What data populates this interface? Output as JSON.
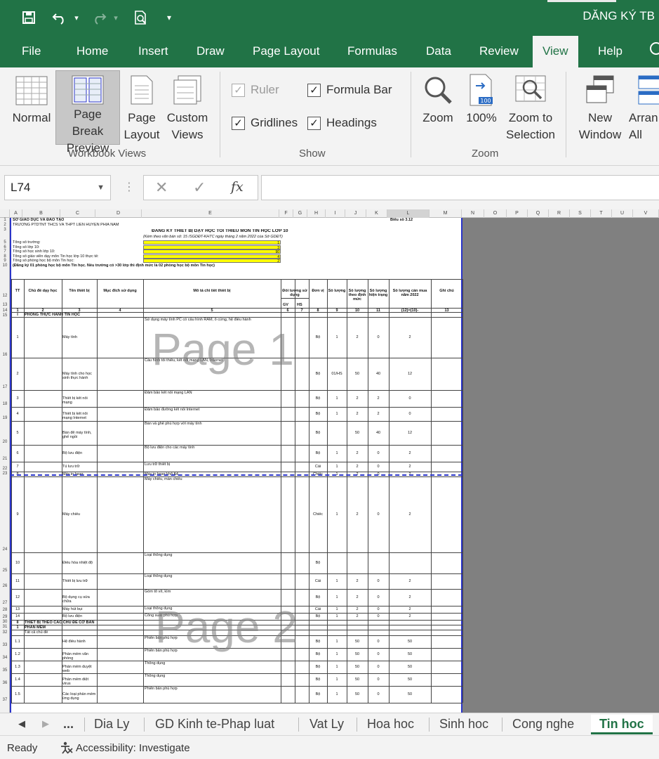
{
  "app": {
    "doc_title": "DĂNG KÝ TB"
  },
  "quick_access": {
    "save": "💾",
    "undo": "↶",
    "redo": "↷",
    "preview": "🔍",
    "customize": "▾"
  },
  "tabs": [
    "File",
    "Home",
    "Insert",
    "Draw",
    "Page Layout",
    "Formulas",
    "Data",
    "Review",
    "View",
    "Help"
  ],
  "ribbon": {
    "workbook_views": {
      "label": "Workbook Views",
      "normal": "Normal",
      "page_break": "Page Break Preview",
      "page_layout": "Page Layout",
      "custom_views": "Custom Views"
    },
    "show": {
      "label": "Show",
      "ruler": "Ruler",
      "formula_bar": "Formula Bar",
      "gridlines": "Gridlines",
      "headings": "Headings"
    },
    "zoom": {
      "label": "Zoom",
      "zoom": "Zoom",
      "hundred": "100%",
      "zoom_sel": "Zoom to Selection"
    },
    "window": {
      "new_window": "New Window",
      "arrange": "Arran All"
    }
  },
  "formula_bar": {
    "name_box": "L74",
    "cancel": "✕",
    "enter": "✓",
    "fx": "fx",
    "value": ""
  },
  "sheet": {
    "columns": [
      "A",
      "B",
      "C",
      "D",
      "E",
      "F",
      "G",
      "H",
      "I",
      "J",
      "K",
      "L",
      "M",
      "N",
      "O",
      "P",
      "Q",
      "R",
      "S",
      "T",
      "U",
      "V"
    ],
    "header_left": "SỞ GIÁO DỤC VÀ ĐÀO TẠO",
    "header_left2": "TRƯỜNG PTDTNT THCS VÀ THPT LIÊN HUYỆN PHÍA NAM",
    "header_right": "Biểu số 3.12",
    "title": "ĐĂNG KÝ THIẾT BỊ DẠY HỌC TỐI THIỂU MÔN TIN HỌC LỚP 10",
    "subtitle": "(Kèm theo văn bản số: 15 /SGDĐT-KHTC ngày tháng 2 năm 2022 của Sở GDĐT)",
    "info": [
      "Tổng số trường:",
      "Tổng số lớp 10:",
      "Tổng số học sinh lớp 10:",
      "Tổng số giáo viên dạy môn Tin học lớp 10 thực tế:",
      "Tổng số phòng học bộ môn Tin học:",
      "(Đăng ký 01 phòng học bộ môn Tin học. Nếu trường có >30 lớp thì định mức là 02 phòng học bộ môn Tin học)"
    ],
    "info_values": [
      "1",
      "3",
      "90",
      "4",
      "2"
    ],
    "headers": [
      "TT",
      "Chủ đề dạy học",
      "Tên thiết bị",
      "Mục đích sử dụng",
      "Mô tả chi tiết thiết bị",
      "Đối tượng sử dụng",
      "Đơn vị",
      "Số lượng",
      "Số lượng theo định mức",
      "Số lượng hiện trạng",
      "Số lượng cần mua năm 2022",
      "Ghi chú"
    ],
    "headers_sub": [
      "GV",
      "HS"
    ],
    "header_nums": [
      "1",
      "2",
      "3",
      "4",
      "5",
      "6",
      "7",
      "8",
      "9",
      "10",
      "11",
      "(12)=(10)-",
      "13"
    ],
    "rows": [
      {
        "tt": "I",
        "name": "PHÒNG THỰC HÀNH TIN HỌC",
        "desc": "",
        "unit": "",
        "qty": "",
        "norm": "",
        "cur": "",
        "need": ""
      },
      {
        "tt": "1",
        "name": "Máy tính",
        "desc": "Sử dụng máy tính PC có cấu hình RAM, ổ cứng, hệ điều hành",
        "unit": "Bộ",
        "qty": "1",
        "norm": "2",
        "cur": "0",
        "need": "2"
      },
      {
        "tt": "2",
        "name": "Máy tính cho học sinh thực hành",
        "desc": "Cấu hình tối thiểu, kết nối mạng LAN, Internet",
        "unit": "Bộ",
        "qty": "01/HS",
        "norm": "50",
        "cur": "40",
        "need": "12"
      },
      {
        "tt": "3",
        "name": "Thiết bị kết nối mạng",
        "desc": "Đảm bảo kết nối mạng LAN",
        "unit": "Bộ",
        "qty": "1",
        "norm": "2",
        "cur": "2",
        "need": "0"
      },
      {
        "tt": "4",
        "name": "Thiết bị kết nối mạng Internet",
        "desc": "Đảm bảo đường kết nối Internet",
        "unit": "Bộ",
        "qty": "1",
        "norm": "2",
        "cur": "2",
        "need": "0"
      },
      {
        "tt": "5",
        "name": "Bàn để máy tính, ghế ngồi",
        "desc": "Bàn và ghế phù hợp với máy tính",
        "unit": "Bộ",
        "qty": "",
        "norm": "50",
        "cur": "40",
        "need": "12"
      },
      {
        "tt": "6",
        "name": "Bộ lưu điện",
        "desc": "Bộ lưu điện cho các máy tính",
        "unit": "Bộ",
        "qty": "1",
        "norm": "2",
        "cur": "0",
        "need": "2"
      },
      {
        "tt": "7",
        "name": "Tủ lưu trữ",
        "desc": "Lưu trữ thiết bị",
        "unit": "Cái",
        "qty": "1",
        "norm": "2",
        "cur": "0",
        "need": "2"
      },
      {
        "tt": "8",
        "name": "Máy in laser",
        "desc": "Máy in laser khổ A4",
        "unit": "Chiếc",
        "qty": "1",
        "norm": "2",
        "cur": "0",
        "need": "2"
      },
      {
        "tt": "9",
        "name": "Máy chiếu",
        "desc": "Máy chiếu, màn chiếu",
        "unit": "Chiếc",
        "qty": "1",
        "norm": "2",
        "cur": "0",
        "need": "2"
      },
      {
        "tt": "10",
        "name": "Điều hòa nhiệt độ",
        "desc": "Loại thông dụng",
        "unit": "Bộ",
        "qty": "",
        "norm": "",
        "cur": "",
        "need": ""
      },
      {
        "tt": "11",
        "name": "Thiết bị lưu trữ",
        "desc": "Loại thông dụng",
        "unit": "Cái",
        "qty": "1",
        "norm": "2",
        "cur": "0",
        "need": "2"
      },
      {
        "tt": "12",
        "name": "Bộ dụng cụ sửa chữa",
        "desc": "Gồm tô vít, kìm",
        "unit": "Bộ",
        "qty": "1",
        "norm": "2",
        "cur": "0",
        "need": "2"
      },
      {
        "tt": "13",
        "name": "Máy hút bụi",
        "desc": "Loại thông dụng",
        "unit": "Cái",
        "qty": "1",
        "norm": "2",
        "cur": "0",
        "need": "2"
      },
      {
        "tt": "14",
        "name": "Bộ lưu điện",
        "desc": "Công suất phù hợp",
        "unit": "Bộ",
        "qty": "1",
        "norm": "2",
        "cur": "0",
        "need": "2"
      },
      {
        "tt": "II",
        "name": "THIẾT BỊ THEO CÁC CHỦ ĐỀ CƠ BẢN",
        "desc": "",
        "unit": "",
        "qty": "",
        "norm": "",
        "cur": "",
        "need": ""
      },
      {
        "tt": "1",
        "name": "PHẦN MỀM",
        "desc": "",
        "unit": "",
        "qty": "",
        "norm": "",
        "cur": "",
        "need": ""
      },
      {
        "tt": "",
        "name": "Tất cả chủ đề",
        "desc": "",
        "unit": "",
        "qty": "",
        "norm": "",
        "cur": "",
        "need": ""
      },
      {
        "tt": "1.1",
        "name": "Hệ điều hành",
        "desc": "Phiên bản phù hợp",
        "unit": "Bộ",
        "qty": "1",
        "norm": "50",
        "cur": "0",
        "need": "50"
      },
      {
        "tt": "1.2",
        "name": "Phần mềm văn phòng",
        "desc": "Phiên bản phù hợp",
        "unit": "Bộ",
        "qty": "1",
        "norm": "50",
        "cur": "0",
        "need": "50"
      },
      {
        "tt": "1.3",
        "name": "Phần mềm duyệt web",
        "desc": "Thông dụng",
        "unit": "Bộ",
        "qty": "1",
        "norm": "50",
        "cur": "0",
        "need": "50"
      },
      {
        "tt": "1.4",
        "name": "Phần mềm diệt virus",
        "desc": "Thông dụng",
        "unit": "Bộ",
        "qty": "1",
        "norm": "50",
        "cur": "0",
        "need": "50"
      },
      {
        "tt": "1.5",
        "name": "Các loại phần mềm ứng dụng",
        "desc": "Phiên bản phù hợp",
        "unit": "Bộ",
        "qty": "1",
        "norm": "50",
        "cur": "0",
        "need": "50"
      }
    ],
    "watermark1": "Page 1",
    "watermark2": "Page 2"
  },
  "sheet_tabs": [
    "...",
    "Dia Ly",
    "GD Kinh te-Phap luat",
    "Vat Ly",
    "Hoa hoc",
    "Sinh hoc",
    "Cong nghe",
    "Tin hoc"
  ],
  "status": {
    "ready": "Ready",
    "accessibility": "Accessibility: Investigate"
  },
  "colors": {
    "brand": "#217346",
    "page_border": "#2b35c9",
    "highlight": "#ffff00"
  }
}
